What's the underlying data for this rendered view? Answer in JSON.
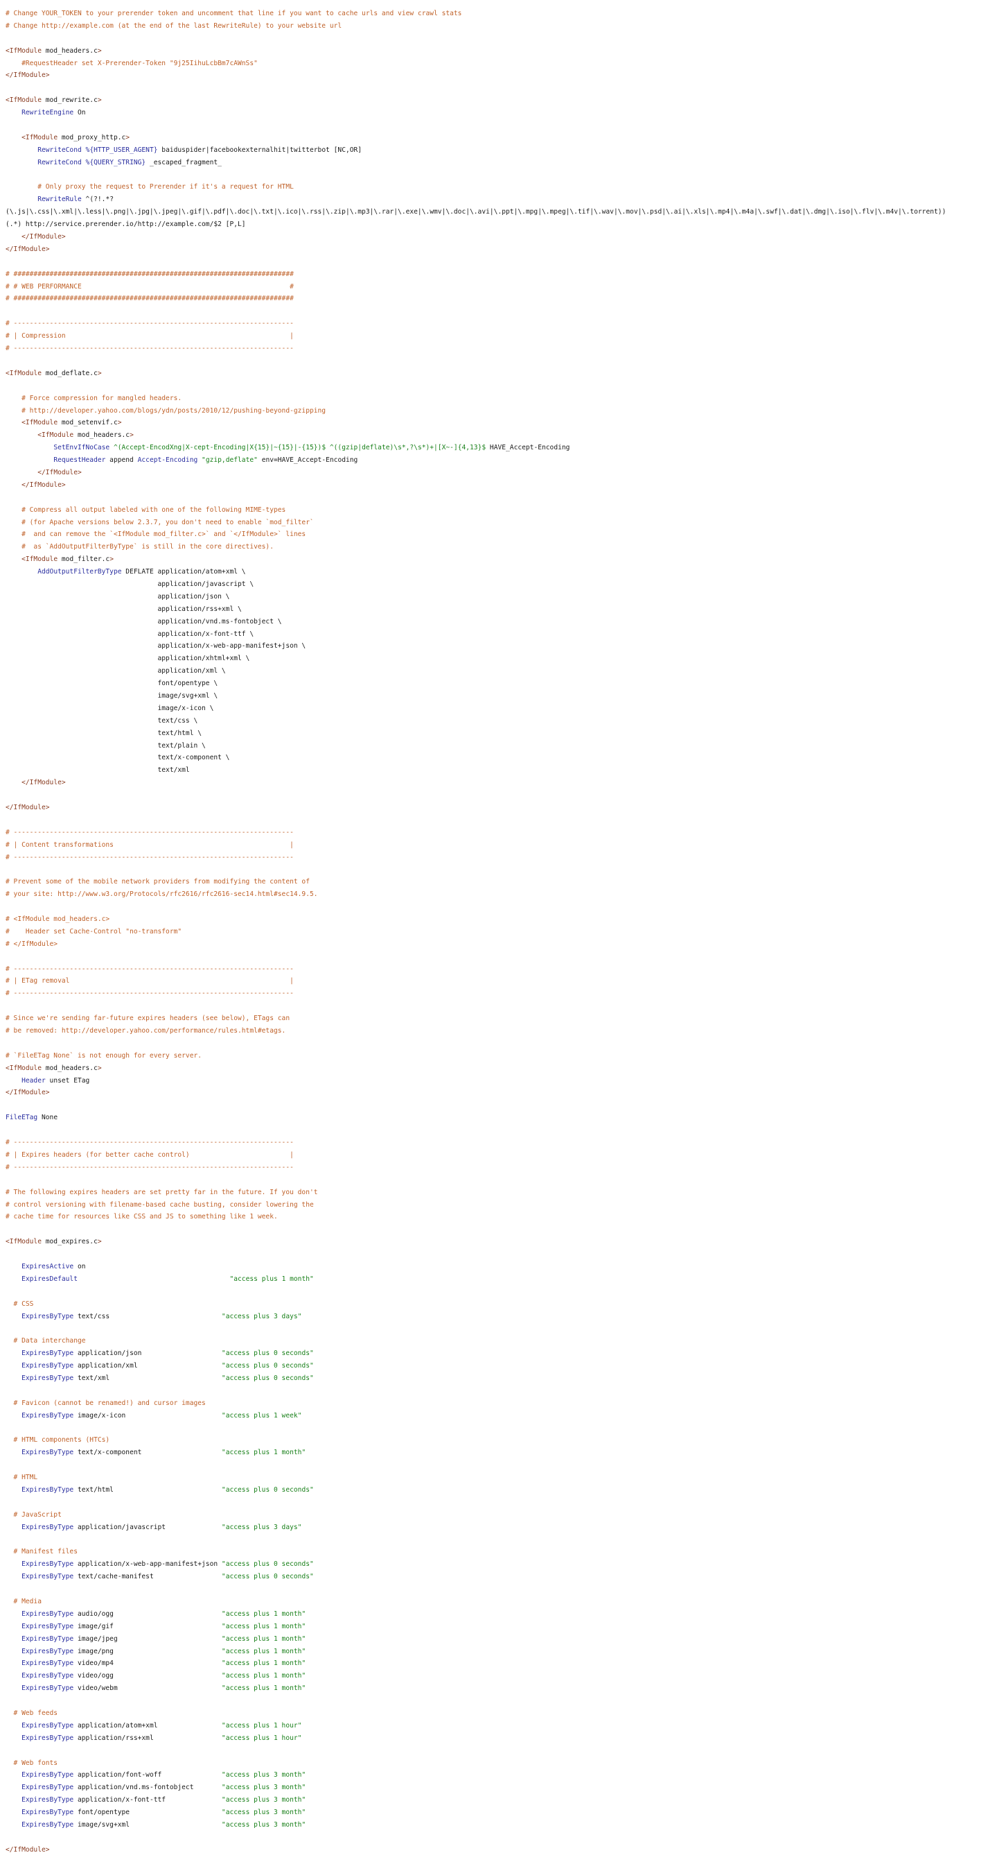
{
  "lines": [
    [
      [
        "c",
        "# Change YOUR_TOKEN to your prerender token and uncomment that line if you want to cache urls and view crawl stats"
      ]
    ],
    [
      [
        "c",
        "# Change http://example.com (at the end of the last RewriteRule) to your website url"
      ]
    ],
    [],
    [
      [
        "t",
        "<IfModule"
      ],
      [
        "p",
        " mod_headers.c"
      ],
      [
        "t",
        ">"
      ]
    ],
    [
      [
        "c",
        "    #RequestHeader set X-Prerender-Token \"9j25IihuLcbBm7cAWnSs\""
      ]
    ],
    [
      [
        "t",
        "</IfModule>"
      ]
    ],
    [],
    [
      [
        "t",
        "<IfModule"
      ],
      [
        "p",
        " mod_rewrite.c"
      ],
      [
        "t",
        ">"
      ]
    ],
    [
      [
        "p",
        "    "
      ],
      [
        "d",
        "RewriteEngine"
      ],
      [
        "p",
        " On"
      ]
    ],
    [],
    [
      [
        "p",
        "    "
      ],
      [
        "t",
        "<IfModule"
      ],
      [
        "p",
        " mod_proxy_http.c"
      ],
      [
        "t",
        ">"
      ]
    ],
    [
      [
        "p",
        "        "
      ],
      [
        "d",
        "RewriteCond"
      ],
      [
        "p",
        " "
      ],
      [
        "v",
        "%{HTTP_USER_AGENT}"
      ],
      [
        "p",
        " baiduspider|facebookexternalhit|twitterbot [NC,OR]"
      ]
    ],
    [
      [
        "p",
        "        "
      ],
      [
        "d",
        "RewriteCond"
      ],
      [
        "p",
        " "
      ],
      [
        "v",
        "%{QUERY_STRING}"
      ],
      [
        "p",
        " _escaped_fragment_"
      ]
    ],
    [],
    [
      [
        "c",
        "        # Only proxy the request to Prerender if it's a request for HTML"
      ]
    ],
    [
      [
        "p",
        "        "
      ],
      [
        "d",
        "RewriteRule"
      ],
      [
        "p",
        " ^(?!.*?"
      ]
    ],
    [
      [
        "p",
        "(\\.js|\\.css|\\.xml|\\.less|\\.png|\\.jpg|\\.jpeg|\\.gif|\\.pdf|\\.doc|\\.txt|\\.ico|\\.rss|\\.zip|\\.mp3|\\.rar|\\.exe|\\.wmv|\\.doc|\\.avi|\\.ppt|\\.mpg|\\.mpeg|\\.tif|\\.wav|\\.mov|\\.psd|\\.ai|\\.xls|\\.mp4|\\.m4a|\\.swf|\\.dat|\\.dmg|\\.iso|\\.flv|\\.m4v|\\.torrent))"
      ]
    ],
    [
      [
        "p",
        "(.*) http://service.prerender.io/http://example.com/$2 [P,L]"
      ]
    ],
    [
      [
        "p",
        "    "
      ],
      [
        "t",
        "</IfModule>"
      ]
    ],
    [
      [
        "t",
        "</IfModule>"
      ]
    ],
    [],
    [
      [
        "c",
        "# ######################################################################"
      ]
    ],
    [
      [
        "c",
        "# # WEB PERFORMANCE                                                    #"
      ]
    ],
    [
      [
        "c",
        "# ######################################################################"
      ]
    ],
    [],
    [
      [
        "c",
        "# ----------------------------------------------------------------------"
      ]
    ],
    [
      [
        "c",
        "# | Compression                                                        |"
      ]
    ],
    [
      [
        "c",
        "# ----------------------------------------------------------------------"
      ]
    ],
    [],
    [
      [
        "t",
        "<IfModule"
      ],
      [
        "p",
        " mod_deflate.c"
      ],
      [
        "t",
        ">"
      ]
    ],
    [],
    [
      [
        "c",
        "    # Force compression for mangled headers."
      ]
    ],
    [
      [
        "c",
        "    # http://developer.yahoo.com/blogs/ydn/posts/2010/12/pushing-beyond-gzipping"
      ]
    ],
    [
      [
        "p",
        "    "
      ],
      [
        "t",
        "<IfModule"
      ],
      [
        "p",
        " mod_setenvif.c"
      ],
      [
        "t",
        ">"
      ]
    ],
    [
      [
        "p",
        "        "
      ],
      [
        "t",
        "<IfModule"
      ],
      [
        "p",
        " mod_headers.c"
      ],
      [
        "t",
        ">"
      ]
    ],
    [
      [
        "p",
        "            "
      ],
      [
        "d",
        "SetEnvIfNoCase"
      ],
      [
        "p",
        " "
      ],
      [
        "s",
        "^(Accept-EncodXng|X-cept-Encoding|X{15}|~{15}|-{15})$"
      ],
      [
        "p",
        " "
      ],
      [
        "s",
        "^((gzip|deflate)\\s*,?\\s*)+|[X~-]{4,13}$"
      ],
      [
        "p",
        " HAVE_Accept-Encoding"
      ]
    ],
    [
      [
        "p",
        "            "
      ],
      [
        "d",
        "RequestHeader"
      ],
      [
        "p",
        " append "
      ],
      [
        "d",
        "Accept-Encoding"
      ],
      [
        "p",
        " "
      ],
      [
        "s",
        "\"gzip,deflate\""
      ],
      [
        "p",
        " env=HAVE_Accept-Encoding"
      ]
    ],
    [
      [
        "p",
        "        "
      ],
      [
        "t",
        "</IfModule>"
      ]
    ],
    [
      [
        "p",
        "    "
      ],
      [
        "t",
        "</IfModule>"
      ]
    ],
    [],
    [
      [
        "c",
        "    # Compress all output labeled with one of the following MIME-types"
      ]
    ],
    [
      [
        "c",
        "    # (for Apache versions below 2.3.7, you don't need to enable `mod_filter`"
      ]
    ],
    [
      [
        "c",
        "    #  and can remove the `<IfModule mod_filter.c>` and `</IfModule>` lines"
      ]
    ],
    [
      [
        "c",
        "    #  as `AddOutputFilterByType` is still in the core directives)."
      ]
    ],
    [
      [
        "p",
        "    "
      ],
      [
        "t",
        "<IfModule"
      ],
      [
        "p",
        " mod_filter.c"
      ],
      [
        "t",
        ">"
      ]
    ],
    [
      [
        "p",
        "        "
      ],
      [
        "d",
        "AddOutputFilterByType"
      ],
      [
        "p",
        " DEFLATE application/atom+xml \\"
      ]
    ],
    [
      [
        "p",
        "                                      application/javascript \\"
      ]
    ],
    [
      [
        "p",
        "                                      application/json \\"
      ]
    ],
    [
      [
        "p",
        "                                      application/rss+xml \\"
      ]
    ],
    [
      [
        "p",
        "                                      application/vnd.ms-fontobject \\"
      ]
    ],
    [
      [
        "p",
        "                                      application/x-font-ttf \\"
      ]
    ],
    [
      [
        "p",
        "                                      application/x-web-app-manifest+json \\"
      ]
    ],
    [
      [
        "p",
        "                                      application/xhtml+xml \\"
      ]
    ],
    [
      [
        "p",
        "                                      application/xml \\"
      ]
    ],
    [
      [
        "p",
        "                                      font/opentype \\"
      ]
    ],
    [
      [
        "p",
        "                                      image/svg+xml \\"
      ]
    ],
    [
      [
        "p",
        "                                      image/x-icon \\"
      ]
    ],
    [
      [
        "p",
        "                                      text/css \\"
      ]
    ],
    [
      [
        "p",
        "                                      text/html \\"
      ]
    ],
    [
      [
        "p",
        "                                      text/plain \\"
      ]
    ],
    [
      [
        "p",
        "                                      text/x-component \\"
      ]
    ],
    [
      [
        "p",
        "                                      text/xml"
      ]
    ],
    [
      [
        "p",
        "    "
      ],
      [
        "t",
        "</IfModule>"
      ]
    ],
    [],
    [
      [
        "t",
        "</IfModule>"
      ]
    ],
    [],
    [
      [
        "c",
        "# ----------------------------------------------------------------------"
      ]
    ],
    [
      [
        "c",
        "# | Content transformations                                            |"
      ]
    ],
    [
      [
        "c",
        "# ----------------------------------------------------------------------"
      ]
    ],
    [],
    [
      [
        "c",
        "# Prevent some of the mobile network providers from modifying the content of"
      ]
    ],
    [
      [
        "c",
        "# your site: http://www.w3.org/Protocols/rfc2616/rfc2616-sec14.html#sec14.9.5."
      ]
    ],
    [],
    [
      [
        "c",
        "# <IfModule mod_headers.c>"
      ]
    ],
    [
      [
        "c",
        "#    Header set Cache-Control \"no-transform\""
      ]
    ],
    [
      [
        "c",
        "# </IfModule>"
      ]
    ],
    [],
    [
      [
        "c",
        "# ----------------------------------------------------------------------"
      ]
    ],
    [
      [
        "c",
        "# | ETag removal                                                       |"
      ]
    ],
    [
      [
        "c",
        "# ----------------------------------------------------------------------"
      ]
    ],
    [],
    [
      [
        "c",
        "# Since we're sending far-future expires headers (see below), ETags can"
      ]
    ],
    [
      [
        "c",
        "# be removed: http://developer.yahoo.com/performance/rules.html#etags."
      ]
    ],
    [],
    [
      [
        "c",
        "# `FileETag None` is not enough for every server."
      ]
    ],
    [
      [
        "t",
        "<IfModule"
      ],
      [
        "p",
        " mod_headers.c"
      ],
      [
        "t",
        ">"
      ]
    ],
    [
      [
        "p",
        "    "
      ],
      [
        "d",
        "Header"
      ],
      [
        "p",
        " unset ETag"
      ]
    ],
    [
      [
        "t",
        "</IfModule>"
      ]
    ],
    [],
    [
      [
        "d",
        "FileETag"
      ],
      [
        "p",
        " None"
      ]
    ],
    [],
    [
      [
        "c",
        "# ----------------------------------------------------------------------"
      ]
    ],
    [
      [
        "c",
        "# | Expires headers (for better cache control)                         |"
      ]
    ],
    [
      [
        "c",
        "# ----------------------------------------------------------------------"
      ]
    ],
    [],
    [
      [
        "c",
        "# The following expires headers are set pretty far in the future. If you don't"
      ]
    ],
    [
      [
        "c",
        "# control versioning with filename-based cache busting, consider lowering the"
      ]
    ],
    [
      [
        "c",
        "# cache time for resources like CSS and JS to something like 1 week."
      ]
    ],
    [],
    [
      [
        "t",
        "<IfModule"
      ],
      [
        "p",
        " mod_expires.c"
      ],
      [
        "t",
        ">"
      ]
    ],
    [],
    [
      [
        "p",
        "    "
      ],
      [
        "d",
        "ExpiresActive"
      ],
      [
        "p",
        " on"
      ]
    ],
    [
      [
        "p",
        "    "
      ],
      [
        "d",
        "ExpiresDefault"
      ],
      [
        "p",
        "                                      "
      ],
      [
        "s",
        "\"access plus 1 month\""
      ]
    ],
    [],
    [
      [
        "c",
        "  # CSS"
      ]
    ],
    [
      [
        "p",
        "    "
      ],
      [
        "d",
        "ExpiresByType"
      ],
      [
        "p",
        " text/css                            "
      ],
      [
        "s",
        "\"access plus 3 days\""
      ]
    ],
    [],
    [
      [
        "c",
        "  # Data interchange"
      ]
    ],
    [
      [
        "p",
        "    "
      ],
      [
        "d",
        "ExpiresByType"
      ],
      [
        "p",
        " application/json                    "
      ],
      [
        "s",
        "\"access plus 0 seconds\""
      ]
    ],
    [
      [
        "p",
        "    "
      ],
      [
        "d",
        "ExpiresByType"
      ],
      [
        "p",
        " application/xml                     "
      ],
      [
        "s",
        "\"access plus 0 seconds\""
      ]
    ],
    [
      [
        "p",
        "    "
      ],
      [
        "d",
        "ExpiresByType"
      ],
      [
        "p",
        " text/xml                            "
      ],
      [
        "s",
        "\"access plus 0 seconds\""
      ]
    ],
    [],
    [
      [
        "c",
        "  # Favicon (cannot be renamed!) and cursor images"
      ]
    ],
    [
      [
        "p",
        "    "
      ],
      [
        "d",
        "ExpiresByType"
      ],
      [
        "p",
        " image/x-icon                        "
      ],
      [
        "s",
        "\"access plus 1 week\""
      ]
    ],
    [],
    [
      [
        "c",
        "  # HTML components (HTCs)"
      ]
    ],
    [
      [
        "p",
        "    "
      ],
      [
        "d",
        "ExpiresByType"
      ],
      [
        "p",
        " text/x-component                    "
      ],
      [
        "s",
        "\"access plus 1 month\""
      ]
    ],
    [],
    [
      [
        "c",
        "  # HTML"
      ]
    ],
    [
      [
        "p",
        "    "
      ],
      [
        "d",
        "ExpiresByType"
      ],
      [
        "p",
        " text/html                           "
      ],
      [
        "s",
        "\"access plus 0 seconds\""
      ]
    ],
    [],
    [
      [
        "c",
        "  # JavaScript"
      ]
    ],
    [
      [
        "p",
        "    "
      ],
      [
        "d",
        "ExpiresByType"
      ],
      [
        "p",
        " application/javascript              "
      ],
      [
        "s",
        "\"access plus 3 days\""
      ]
    ],
    [],
    [
      [
        "c",
        "  # Manifest files"
      ]
    ],
    [
      [
        "p",
        "    "
      ],
      [
        "d",
        "ExpiresByType"
      ],
      [
        "p",
        " application/x-web-app-manifest+json "
      ],
      [
        "s",
        "\"access plus 0 seconds\""
      ]
    ],
    [
      [
        "p",
        "    "
      ],
      [
        "d",
        "ExpiresByType"
      ],
      [
        "p",
        " text/cache-manifest                 "
      ],
      [
        "s",
        "\"access plus 0 seconds\""
      ]
    ],
    [],
    [
      [
        "c",
        "  # Media"
      ]
    ],
    [
      [
        "p",
        "    "
      ],
      [
        "d",
        "ExpiresByType"
      ],
      [
        "p",
        " audio/ogg                           "
      ],
      [
        "s",
        "\"access plus 1 month\""
      ]
    ],
    [
      [
        "p",
        "    "
      ],
      [
        "d",
        "ExpiresByType"
      ],
      [
        "p",
        " image/gif                           "
      ],
      [
        "s",
        "\"access plus 1 month\""
      ]
    ],
    [
      [
        "p",
        "    "
      ],
      [
        "d",
        "ExpiresByType"
      ],
      [
        "p",
        " image/jpeg                          "
      ],
      [
        "s",
        "\"access plus 1 month\""
      ]
    ],
    [
      [
        "p",
        "    "
      ],
      [
        "d",
        "ExpiresByType"
      ],
      [
        "p",
        " image/png                           "
      ],
      [
        "s",
        "\"access plus 1 month\""
      ]
    ],
    [
      [
        "p",
        "    "
      ],
      [
        "d",
        "ExpiresByType"
      ],
      [
        "p",
        " video/mp4                           "
      ],
      [
        "s",
        "\"access plus 1 month\""
      ]
    ],
    [
      [
        "p",
        "    "
      ],
      [
        "d",
        "ExpiresByType"
      ],
      [
        "p",
        " video/ogg                           "
      ],
      [
        "s",
        "\"access plus 1 month\""
      ]
    ],
    [
      [
        "p",
        "    "
      ],
      [
        "d",
        "ExpiresByType"
      ],
      [
        "p",
        " video/webm                          "
      ],
      [
        "s",
        "\"access plus 1 month\""
      ]
    ],
    [],
    [
      [
        "c",
        "  # Web feeds"
      ]
    ],
    [
      [
        "p",
        "    "
      ],
      [
        "d",
        "ExpiresByType"
      ],
      [
        "p",
        " application/atom+xml                "
      ],
      [
        "s",
        "\"access plus 1 hour\""
      ]
    ],
    [
      [
        "p",
        "    "
      ],
      [
        "d",
        "ExpiresByType"
      ],
      [
        "p",
        " application/rss+xml                 "
      ],
      [
        "s",
        "\"access plus 1 hour\""
      ]
    ],
    [],
    [
      [
        "c",
        "  # Web fonts"
      ]
    ],
    [
      [
        "p",
        "    "
      ],
      [
        "d",
        "ExpiresByType"
      ],
      [
        "p",
        " application/font-woff               "
      ],
      [
        "s",
        "\"access plus 3 month\""
      ]
    ],
    [
      [
        "p",
        "    "
      ],
      [
        "d",
        "ExpiresByType"
      ],
      [
        "p",
        " application/vnd.ms-fontobject       "
      ],
      [
        "s",
        "\"access plus 3 month\""
      ]
    ],
    [
      [
        "p",
        "    "
      ],
      [
        "d",
        "ExpiresByType"
      ],
      [
        "p",
        " application/x-font-ttf              "
      ],
      [
        "s",
        "\"access plus 3 month\""
      ]
    ],
    [
      [
        "p",
        "    "
      ],
      [
        "d",
        "ExpiresByType"
      ],
      [
        "p",
        " font/opentype                       "
      ],
      [
        "s",
        "\"access plus 3 month\""
      ]
    ],
    [
      [
        "p",
        "    "
      ],
      [
        "d",
        "ExpiresByType"
      ],
      [
        "p",
        " image/svg+xml                       "
      ],
      [
        "s",
        "\"access plus 3 month\""
      ]
    ],
    [],
    [
      [
        "t",
        "</IfModule>"
      ]
    ]
  ]
}
